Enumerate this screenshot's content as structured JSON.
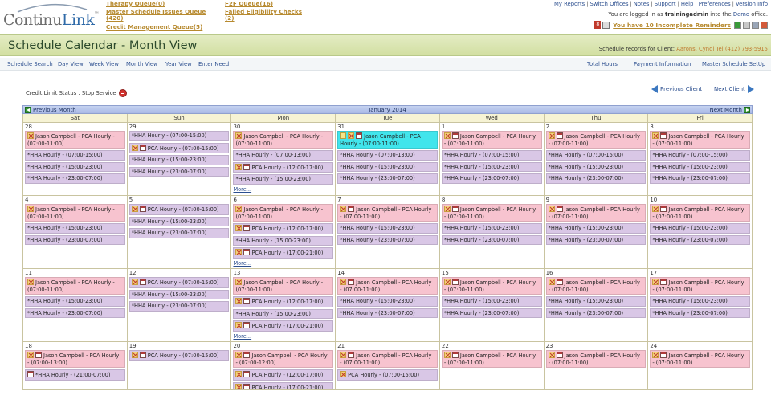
{
  "header": {
    "logo_main": "Continu",
    "logo_accent": "Link",
    "logo_tm": "™",
    "queues": {
      "therapy": "Therapy Queue(0)",
      "master_issues_1": "Master Schedule Issues Queue",
      "master_issues_2": "(420)",
      "credit": "Credit Management Queue(5)",
      "f2f": "F2F Queue(16)",
      "eligibility_1": "Failed Eligibility Checks",
      "eligibility_2": "(2)"
    },
    "top_links": [
      "My Reports",
      "Switch Offices",
      "Notes",
      "Support",
      "Help",
      "Preferences",
      "Version Info"
    ],
    "logged_in_prefix": "You are logged in as",
    "username": "trainingadmin",
    "logged_in_mid": "into the",
    "office": "Demo",
    "logged_in_suffix": "office.",
    "reminder_count": "8",
    "reminder_text": "You have 10 Incomplete Reminders"
  },
  "titlebar": {
    "title": "Schedule Calendar - Month View",
    "client_prefix": "Schedule records for Client:",
    "client_name": "Aarons, Cyndi Tel:(412) 793-5915"
  },
  "subnav": {
    "left": [
      "Schedule Search",
      "Day View",
      "Week View",
      "Month View",
      "Year View",
      "Enter Need"
    ],
    "right": [
      "Total Hours",
      "Payment Information",
      "Master Schedule SetUp"
    ]
  },
  "credit": {
    "label": "Credit Limit Status : Stop Service"
  },
  "client_nav": {
    "prev": "Previous Client",
    "next": "Next Client"
  },
  "calendar": {
    "month_title": "January 2014",
    "prev_month": "Previous Month",
    "next_month": "Next Month",
    "days_of_week": [
      "Sat",
      "Sun",
      "Mon",
      "Tue",
      "Wed",
      "Thu",
      "Fri"
    ],
    "more_label": "More...",
    "weeks": [
      [
        {
          "num": "28",
          "events": [
            {
              "color": "pink",
              "icons": [
                "x"
              ],
              "text": "Jason Campbell - PCA Hourly - (07:00-11:00)"
            },
            {
              "color": "purple",
              "icons": [],
              "text": "*HHA Hourly - (07:00-15:00)"
            },
            {
              "color": "purple",
              "icons": [],
              "text": "*HHA Hourly - (15:00-23:00)"
            },
            {
              "color": "purple",
              "icons": [],
              "text": "*HHA Hourly - (23:00-07:00)"
            }
          ]
        },
        {
          "num": "29",
          "events": [
            {
              "color": "purple",
              "icons": [],
              "text": "*HHA Hourly - (07:00-15:00)"
            },
            {
              "color": "purple",
              "icons": [
                "x",
                "cal"
              ],
              "text": "PCA Hourly - (07:00-15:00)"
            },
            {
              "color": "purple",
              "icons": [],
              "text": "*HHA Hourly - (15:00-23:00)"
            },
            {
              "color": "purple",
              "icons": [],
              "text": "*HHA Hourly - (23:00-07:00)"
            }
          ]
        },
        {
          "num": "30",
          "more": true,
          "events": [
            {
              "color": "pink",
              "icons": [
                "x"
              ],
              "text": "Jason Campbell - PCA Hourly - (07:00-11:00)"
            },
            {
              "color": "purple",
              "icons": [],
              "text": "*HHA Hourly - (07:00-13:00)"
            },
            {
              "color": "purple",
              "icons": [
                "x",
                "cal"
              ],
              "text": "PCA Hourly - (12:00-17:00)"
            },
            {
              "color": "purple",
              "icons": [],
              "text": "*HHA Hourly - (15:00-23:00)"
            }
          ]
        },
        {
          "num": "31",
          "events": [
            {
              "color": "cyan",
              "icons": [
                "note",
                "x",
                "cal"
              ],
              "text": "Jason Campbell - PCA Hourly - (07:00-11:00)"
            },
            {
              "color": "purple",
              "icons": [],
              "text": "*HHA Hourly - (07:00-13:00)"
            },
            {
              "color": "purple",
              "icons": [],
              "text": "*HHA Hourly - (15:00-23:00)"
            },
            {
              "color": "purple",
              "icons": [],
              "text": "*HHA Hourly - (23:00-07:00)"
            }
          ]
        },
        {
          "num": "1",
          "events": [
            {
              "color": "pink",
              "icons": [
                "x",
                "cal"
              ],
              "text": "Jason Campbell - PCA Hourly - (07:00-11:00)"
            },
            {
              "color": "purple",
              "icons": [],
              "text": "*HHA Hourly - (07:00-15:00)"
            },
            {
              "color": "purple",
              "icons": [],
              "text": "*HHA Hourly - (15:00-23:00)"
            },
            {
              "color": "purple",
              "icons": [],
              "text": "*HHA Hourly - (23:00-07:00)"
            }
          ]
        },
        {
          "num": "2",
          "events": [
            {
              "color": "pink",
              "icons": [
                "x",
                "cal"
              ],
              "text": "Jason Campbell - PCA Hourly - (07:00-11:00)"
            },
            {
              "color": "purple",
              "icons": [],
              "text": "*HHA Hourly - (07:00-15:00)"
            },
            {
              "color": "purple",
              "icons": [],
              "text": "*HHA Hourly - (15:00-23:00)"
            },
            {
              "color": "purple",
              "icons": [],
              "text": "*HHA Hourly - (23:00-07:00)"
            }
          ]
        },
        {
          "num": "3",
          "events": [
            {
              "color": "pink",
              "icons": [
                "x",
                "cal"
              ],
              "text": "Jason Campbell - PCA Hourly - (07:00-11:00)"
            },
            {
              "color": "purple",
              "icons": [],
              "text": "*HHA Hourly - (07:00-15:00)"
            },
            {
              "color": "purple",
              "icons": [],
              "text": "*HHA Hourly - (15:00-23:00)"
            },
            {
              "color": "purple",
              "icons": [],
              "text": "*HHA Hourly - (23:00-07:00)"
            }
          ]
        }
      ],
      [
        {
          "num": "4",
          "events": [
            {
              "color": "pink",
              "icons": [
                "x"
              ],
              "text": "Jason Campbell - PCA Hourly - (07:00-11:00)"
            },
            {
              "color": "purple",
              "icons": [],
              "text": "*HHA Hourly - (15:00-23:00)"
            },
            {
              "color": "purple",
              "icons": [],
              "text": "*HHA Hourly - (23:00-07:00)"
            }
          ]
        },
        {
          "num": "5",
          "events": [
            {
              "color": "purple",
              "icons": [
                "x",
                "cal"
              ],
              "text": "PCA Hourly - (07:00-15:00)"
            },
            {
              "color": "purple",
              "icons": [],
              "text": "*HHA Hourly - (15:00-23:00)"
            },
            {
              "color": "purple",
              "icons": [],
              "text": "*HHA Hourly - (23:00-07:00)"
            }
          ]
        },
        {
          "num": "6",
          "more": true,
          "events": [
            {
              "color": "pink",
              "icons": [
                "x"
              ],
              "text": "Jason Campbell - PCA Hourly - (07:00-11:00)"
            },
            {
              "color": "purple",
              "icons": [
                "x",
                "cal"
              ],
              "text": "PCA Hourly - (12:00-17:00)"
            },
            {
              "color": "purple",
              "icons": [],
              "text": "*HHA Hourly - (15:00-23:00)"
            },
            {
              "color": "purple",
              "icons": [
                "x",
                "cal"
              ],
              "text": "PCA Hourly - (17:00-21:00)"
            }
          ]
        },
        {
          "num": "7",
          "events": [
            {
              "color": "pink",
              "icons": [
                "x",
                "cal"
              ],
              "text": "Jason Campbell - PCA Hourly - (07:00-11:00)"
            },
            {
              "color": "purple",
              "icons": [],
              "text": "*HHA Hourly - (15:00-23:00)"
            },
            {
              "color": "purple",
              "icons": [],
              "text": "*HHA Hourly - (23:00-07:00)"
            }
          ]
        },
        {
          "num": "8",
          "events": [
            {
              "color": "pink",
              "icons": [
                "x",
                "cal"
              ],
              "text": "Jason Campbell - PCA Hourly - (07:00-11:00)"
            },
            {
              "color": "purple",
              "icons": [],
              "text": "*HHA Hourly - (15:00-23:00)"
            },
            {
              "color": "purple",
              "icons": [],
              "text": "*HHA Hourly - (23:00-07:00)"
            }
          ]
        },
        {
          "num": "9",
          "events": [
            {
              "color": "pink",
              "icons": [
                "x",
                "cal"
              ],
              "text": "Jason Campbell - PCA Hourly - (07:00-11:00)"
            },
            {
              "color": "purple",
              "icons": [],
              "text": "*HHA Hourly - (15:00-23:00)"
            },
            {
              "color": "purple",
              "icons": [],
              "text": "*HHA Hourly - (23:00-07:00)"
            }
          ]
        },
        {
          "num": "10",
          "events": [
            {
              "color": "pink",
              "icons": [
                "x",
                "cal"
              ],
              "text": "Jason Campbell - PCA Hourly - (07:00-11:00)"
            },
            {
              "color": "purple",
              "icons": [],
              "text": "*HHA Hourly - (15:00-23:00)"
            },
            {
              "color": "purple",
              "icons": [],
              "text": "*HHA Hourly - (23:00-07:00)"
            }
          ]
        }
      ],
      [
        {
          "num": "11",
          "events": [
            {
              "color": "pink",
              "icons": [
                "x"
              ],
              "text": "Jason Campbell - PCA Hourly - (07:00-11:00)"
            },
            {
              "color": "purple",
              "icons": [],
              "text": "*HHA Hourly - (15:00-23:00)"
            },
            {
              "color": "purple",
              "icons": [],
              "text": "*HHA Hourly - (23:00-07:00)"
            }
          ]
        },
        {
          "num": "12",
          "events": [
            {
              "color": "purple",
              "icons": [
                "x",
                "cal"
              ],
              "text": "PCA Hourly - (07:00-15:00)"
            },
            {
              "color": "purple",
              "icons": [],
              "text": "*HHA Hourly - (15:00-23:00)"
            },
            {
              "color": "purple",
              "icons": [],
              "text": "*HHA Hourly - (23:00-07:00)"
            }
          ]
        },
        {
          "num": "13",
          "more": true,
          "events": [
            {
              "color": "pink",
              "icons": [
                "x"
              ],
              "text": "Jason Campbell - PCA Hourly - (07:00-11:00)"
            },
            {
              "color": "purple",
              "icons": [
                "x",
                "cal"
              ],
              "text": "PCA Hourly - (12:00-17:00)"
            },
            {
              "color": "purple",
              "icons": [],
              "text": "*HHA Hourly - (15:00-23:00)"
            },
            {
              "color": "purple",
              "icons": [
                "x",
                "cal"
              ],
              "text": "PCA Hourly - (17:00-21:00)"
            }
          ]
        },
        {
          "num": "14",
          "events": [
            {
              "color": "pink",
              "icons": [
                "x",
                "cal"
              ],
              "text": "Jason Campbell - PCA Hourly - (07:00-11:00)"
            },
            {
              "color": "purple",
              "icons": [],
              "text": "*HHA Hourly - (15:00-23:00)"
            },
            {
              "color": "purple",
              "icons": [],
              "text": "*HHA Hourly - (23:00-07:00)"
            }
          ]
        },
        {
          "num": "15",
          "events": [
            {
              "color": "pink",
              "icons": [
                "x",
                "cal"
              ],
              "text": "Jason Campbell - PCA Hourly - (07:00-11:00)"
            },
            {
              "color": "purple",
              "icons": [],
              "text": "*HHA Hourly - (15:00-23:00)"
            },
            {
              "color": "purple",
              "icons": [],
              "text": "*HHA Hourly - (23:00-07:00)"
            }
          ]
        },
        {
          "num": "16",
          "events": [
            {
              "color": "pink",
              "icons": [
                "x",
                "cal"
              ],
              "text": "Jason Campbell - PCA Hourly - (07:00-11:00)"
            },
            {
              "color": "purple",
              "icons": [],
              "text": "*HHA Hourly - (15:00-23:00)"
            },
            {
              "color": "purple",
              "icons": [],
              "text": "*HHA Hourly - (23:00-07:00)"
            }
          ]
        },
        {
          "num": "17",
          "events": [
            {
              "color": "pink",
              "icons": [
                "x",
                "cal"
              ],
              "text": "Jason Campbell - PCA Hourly - (07:00-11:00)"
            },
            {
              "color": "purple",
              "icons": [],
              "text": "*HHA Hourly - (15:00-23:00)"
            },
            {
              "color": "purple",
              "icons": [],
              "text": "*HHA Hourly - (23:00-07:00)"
            }
          ]
        }
      ],
      [
        {
          "num": "18",
          "events": [
            {
              "color": "pink",
              "icons": [
                "x",
                "cal"
              ],
              "text": "Jason Campbell - PCA Hourly - (07:00-13:00)"
            },
            {
              "color": "purple",
              "icons": [
                "cal"
              ],
              "text": "*HHA Hourly - (21:00-07:00)"
            }
          ]
        },
        {
          "num": "19",
          "events": [
            {
              "color": "purple",
              "icons": [
                "x",
                "cal"
              ],
              "text": "PCA Hourly - (07:00-15:00)"
            }
          ]
        },
        {
          "num": "20",
          "events": [
            {
              "color": "pink",
              "icons": [
                "x",
                "cal"
              ],
              "text": "Jason Campbell - PCA Hourly - (07:00-12:00)"
            },
            {
              "color": "purple",
              "icons": [
                "x",
                "cal"
              ],
              "text": "PCA Hourly - (12:00-17:00)"
            },
            {
              "color": "purple",
              "icons": [
                "x",
                "cal"
              ],
              "text": "PCA Hourly - (17:00-21:00)"
            }
          ]
        },
        {
          "num": "21",
          "events": [
            {
              "color": "pink",
              "icons": [
                "x",
                "cal"
              ],
              "text": "Jason Campbell - PCA Hourly - (07:00-11:00)"
            },
            {
              "color": "purple",
              "icons": [
                "x"
              ],
              "text": "PCA Hourly - (07:00-15:00)"
            }
          ]
        },
        {
          "num": "22",
          "events": [
            {
              "color": "pink",
              "icons": [
                "x",
                "cal"
              ],
              "text": "Jason Campbell - PCA Hourly - (07:00-11:00)"
            }
          ]
        },
        {
          "num": "23",
          "events": [
            {
              "color": "pink",
              "icons": [
                "x",
                "cal"
              ],
              "text": "Jason Campbell - PCA Hourly - (07:00-11:00)"
            }
          ]
        },
        {
          "num": "24",
          "events": [
            {
              "color": "pink",
              "icons": [
                "x",
                "cal"
              ],
              "text": "Jason Campbell - PCA Hourly - (07:00-11:00)"
            }
          ]
        }
      ]
    ]
  },
  "colors": {
    "link": "#2c4f8f",
    "queue_link": "#b78a2f",
    "title_bar": "#d2dfa2",
    "event_pink": "#f7c3cf",
    "event_purple": "#d9c7e6",
    "event_cyan": "#41e5ec",
    "day_header": "#f6f3d4",
    "month_bar": "#a9b9e6"
  }
}
